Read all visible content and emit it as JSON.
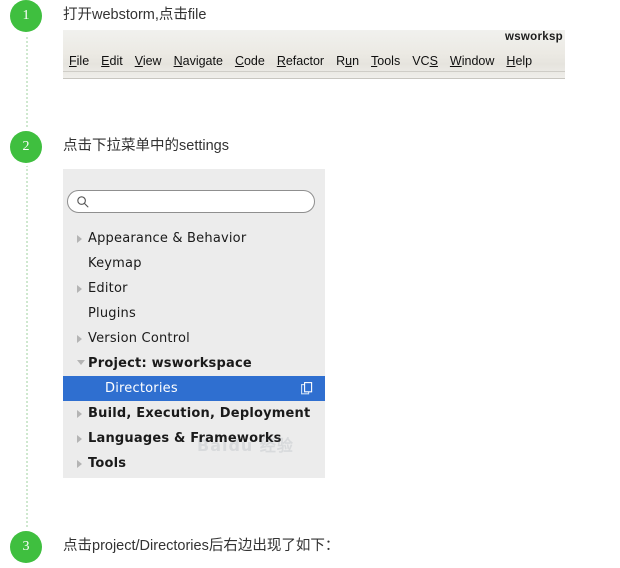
{
  "steps": [
    {
      "number": "1",
      "text": "打开webstorm,点击file"
    },
    {
      "number": "2",
      "text": "点击下拉菜单中的settings"
    },
    {
      "number": "3",
      "text": "点击project/Directories后右边出现了如下："
    }
  ],
  "menubar": {
    "window_title": "wsworksp",
    "items": [
      {
        "pre": "",
        "mnemonic": "F",
        "post": "ile"
      },
      {
        "pre": "",
        "mnemonic": "E",
        "post": "dit"
      },
      {
        "pre": "",
        "mnemonic": "V",
        "post": "iew"
      },
      {
        "pre": "",
        "mnemonic": "N",
        "post": "avigate"
      },
      {
        "pre": "",
        "mnemonic": "C",
        "post": "ode"
      },
      {
        "pre": "",
        "mnemonic": "R",
        "post": "efactor"
      },
      {
        "pre": "R",
        "mnemonic": "u",
        "post": "n"
      },
      {
        "pre": "",
        "mnemonic": "T",
        "post": "ools"
      },
      {
        "pre": "VC",
        "mnemonic": "S",
        "post": ""
      },
      {
        "pre": "",
        "mnemonic": "W",
        "post": "indow"
      },
      {
        "pre": "",
        "mnemonic": "H",
        "post": "elp"
      }
    ]
  },
  "settings": {
    "search_value": "",
    "search_placeholder": "",
    "selection_color": "#2f6fd0",
    "tree": [
      {
        "label": "Appearance & Behavior",
        "arrow": "collapsed",
        "indent": false,
        "bold": false,
        "selected": false
      },
      {
        "label": "Keymap",
        "arrow": "none",
        "indent": false,
        "bold": false,
        "selected": false
      },
      {
        "label": "Editor",
        "arrow": "collapsed",
        "indent": false,
        "bold": false,
        "selected": false
      },
      {
        "label": "Plugins",
        "arrow": "none",
        "indent": false,
        "bold": false,
        "selected": false
      },
      {
        "label": "Version Control",
        "arrow": "collapsed",
        "indent": false,
        "bold": false,
        "selected": false
      },
      {
        "label": "Project: wsworkspace",
        "arrow": "expanded",
        "indent": false,
        "bold": true,
        "selected": false
      },
      {
        "label": "Directories",
        "arrow": "none",
        "indent": true,
        "bold": false,
        "selected": true
      },
      {
        "label": "Build, Execution, Deployment",
        "arrow": "collapsed",
        "indent": false,
        "bold": true,
        "selected": false
      },
      {
        "label": "Languages & Frameworks",
        "arrow": "collapsed",
        "indent": false,
        "bold": true,
        "selected": false
      },
      {
        "label": "Tools",
        "arrow": "collapsed",
        "indent": false,
        "bold": true,
        "selected": false
      }
    ]
  },
  "watermark": {
    "text": "Baidu 经验"
  },
  "theme": {
    "badge_green": "#3fbf3f",
    "rail_dot": "#cfe8cf",
    "panel_bg": "#ececec"
  }
}
